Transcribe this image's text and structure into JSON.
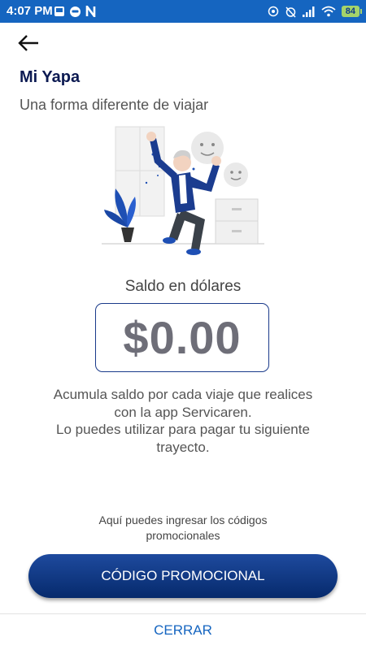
{
  "status_bar": {
    "time": "4:07 PM",
    "battery": "84",
    "left_icons": [
      "gallery-icon",
      "face-app-icon",
      "n-app-icon"
    ],
    "right_icons": [
      "location-icon",
      "alarm-off-icon",
      "signal-icon",
      "wifi-icon",
      "battery-icon"
    ]
  },
  "header": {
    "back_icon": "arrow-left-icon",
    "title": "Mi Yapa",
    "subtitle": "Una forma diferente de viajar"
  },
  "balance": {
    "label": "Saldo en dólares",
    "value": "$0.00"
  },
  "description": {
    "line1": "Acumula saldo por cada viaje que realices",
    "line2": "con la app Servicaren.",
    "line3": "Lo puedes utilizar para pagar tu siguiente",
    "line4": "trayecto."
  },
  "promo": {
    "hint_line1": "Aquí puedes ingresar los códigos",
    "hint_line2": "promocionales",
    "button_label": "CÓDIGO PROMOCIONAL"
  },
  "footer": {
    "close_label": "CERRAR"
  },
  "colors": {
    "status_bar": "#1565c0",
    "title": "#0c1a52",
    "button": "#0a3278",
    "link": "#1565c0",
    "balance_border": "#1a3a8a"
  }
}
